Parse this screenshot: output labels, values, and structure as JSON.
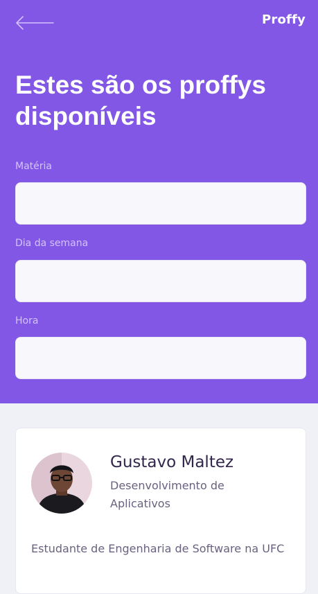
{
  "header": {
    "logo": "Proffy",
    "title": "Estes são os proffys disponíveis",
    "back_icon": "arrow-left-icon"
  },
  "filters": {
    "subject_label": "Matéria",
    "subject_value": "",
    "weekday_label": "Dia da semana",
    "weekday_value": "",
    "time_label": "Hora",
    "time_value": ""
  },
  "teacher": {
    "name": "Gustavo Maltez",
    "subject": "Desenvolvimento de Aplicativos",
    "bio": "Estudante de Engenharia de Software na UFC"
  },
  "colors": {
    "primary": "#8257E5",
    "background": "#F0F0F7",
    "input_background": "#F8F8FC",
    "label": "#D4C2FF",
    "title_text": "#32264D",
    "body_text": "#6A6180"
  }
}
